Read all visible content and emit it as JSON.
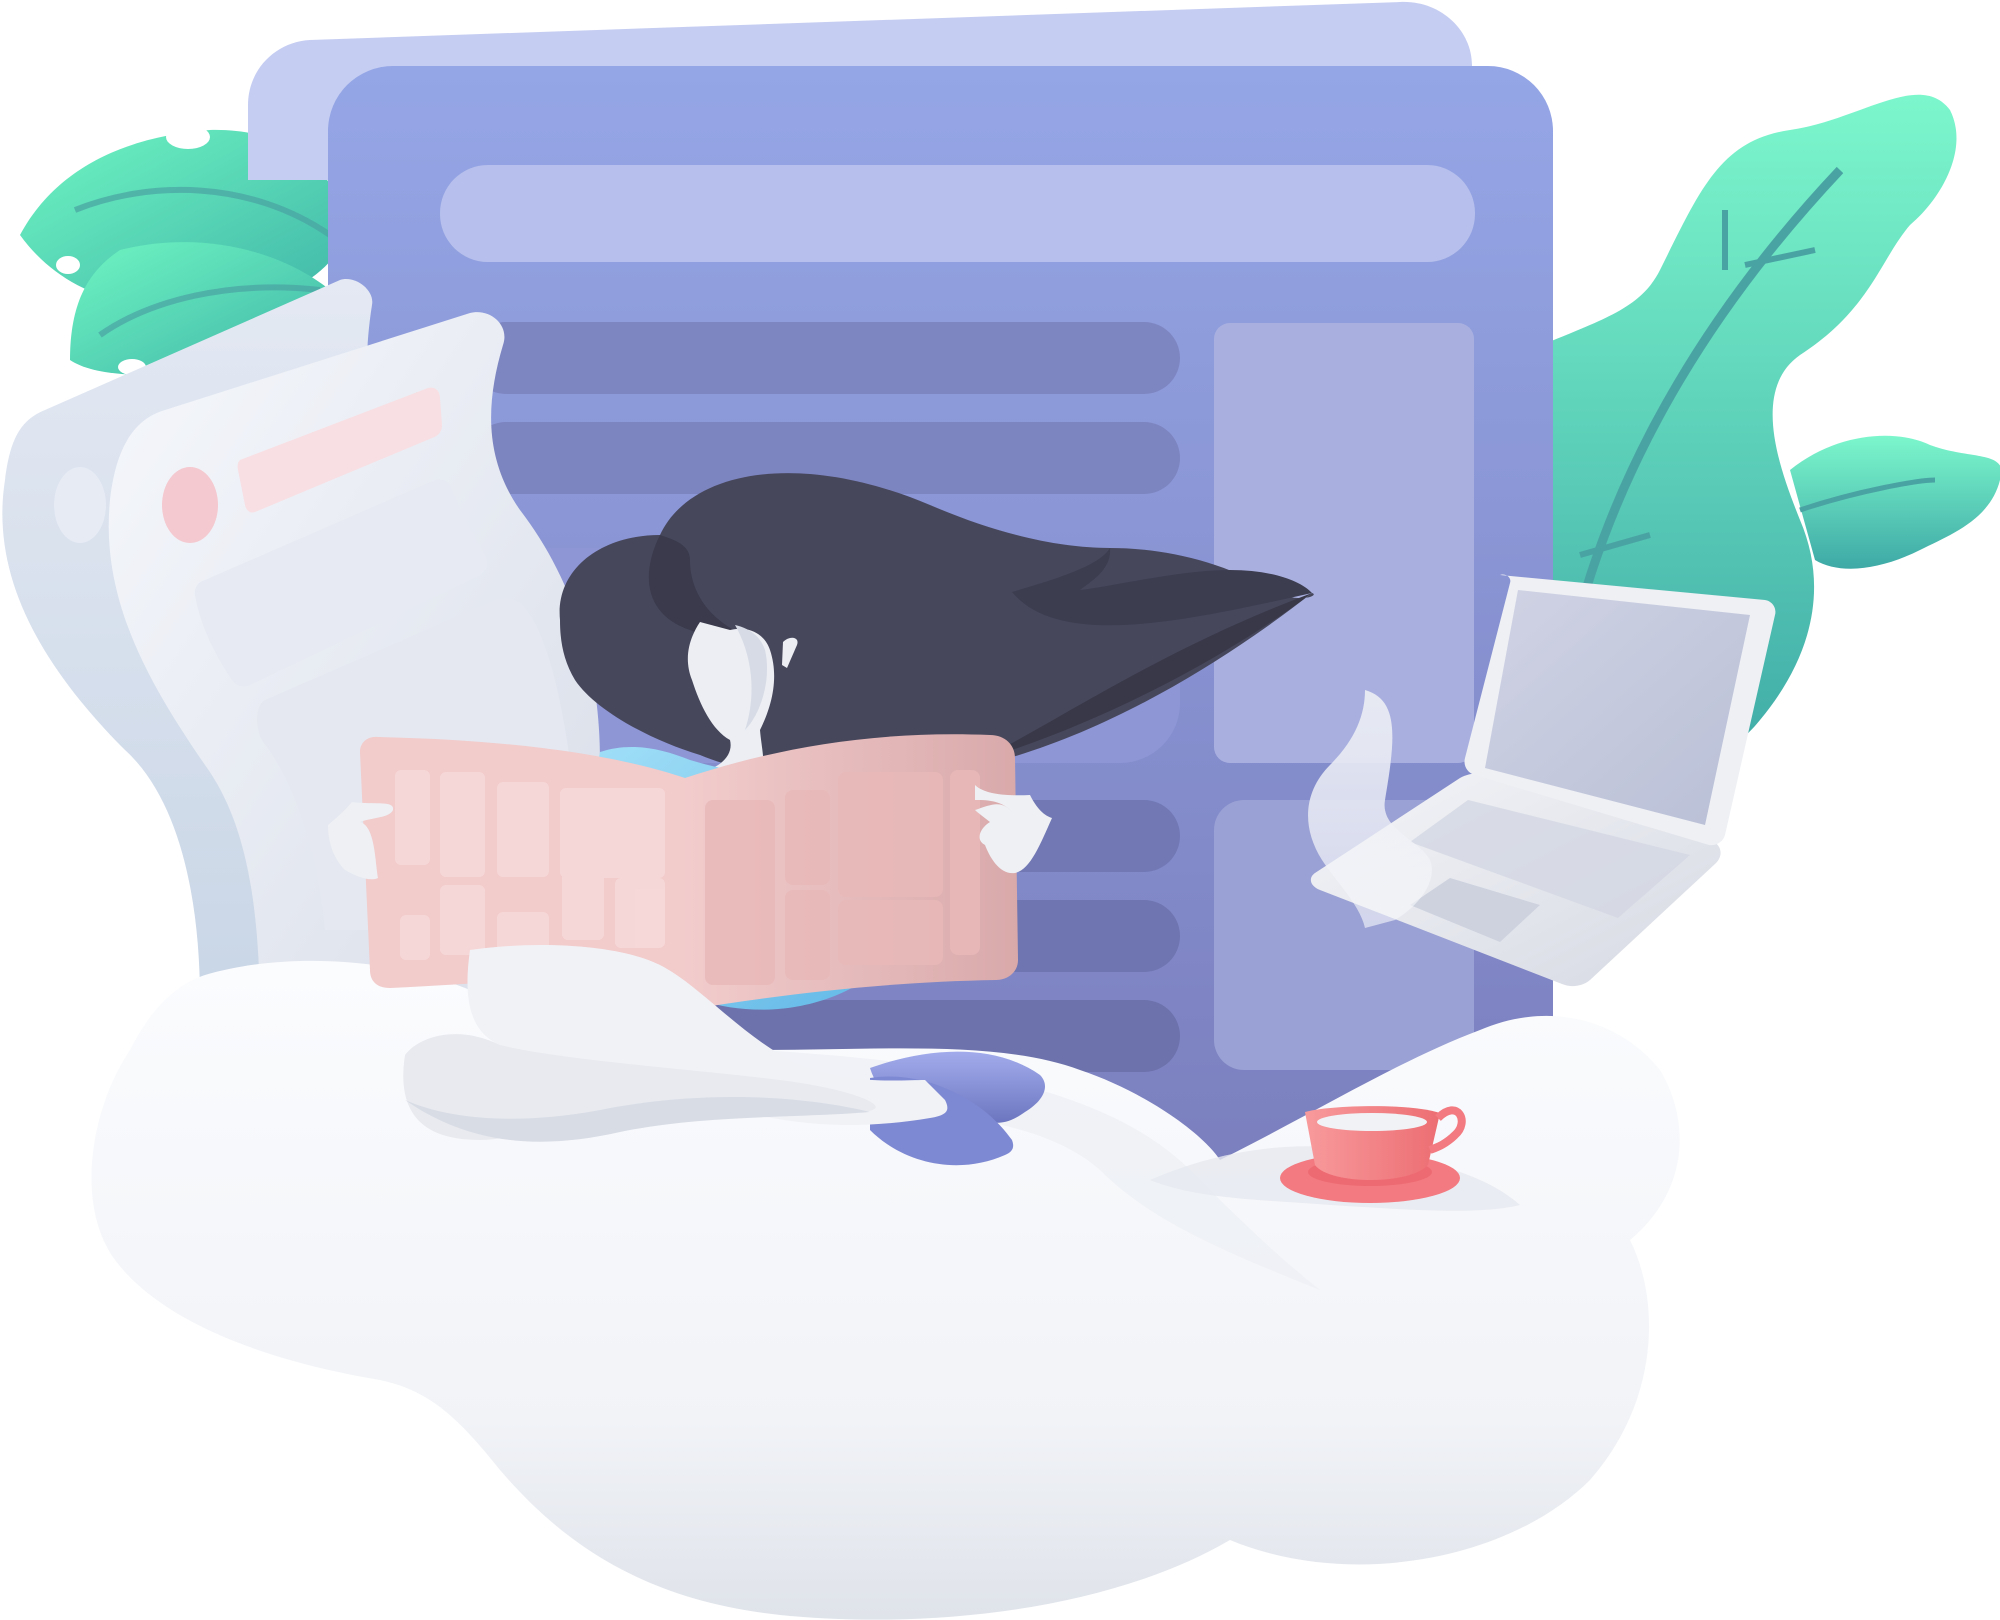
{
  "scene": {
    "subject": "person-reading-newspaper-on-cloud",
    "has_text": false
  },
  "palette": {
    "backdrop_back": "#c5cdf2",
    "backdrop_front_top": "#95a6e6",
    "backdrop_front_bottom": "#7b7fbe",
    "bar_light": "#b7c0ec",
    "bar_dark": "#6f74aa",
    "panel": "#a9b0e0",
    "leaf_light": "#6ff5c2",
    "leaf_dark": "#3fb5a8",
    "leaf_vein": "#4aa3a3",
    "hair": "#47475c",
    "hair_shadow": "#383848",
    "skin": "#f1f2f5",
    "newspaper": "#ecc3c3",
    "newspaper_shade": "#d9a9aa",
    "shirt": "#8bd4f4",
    "pants": "#8d99e3",
    "cloud": "#f7f8fb",
    "cloud_shadow": "#dfe3ea",
    "paper": "#e8ecf4",
    "paper_accent": "#f4c9cf",
    "laptop": "#e8eaf0",
    "laptop_screen": "#c4c9dc",
    "cup": "#f47f82",
    "saucer": "#f26b72"
  },
  "icons": [
    "newspaper-icon",
    "laptop-icon",
    "coffee-cup-icon",
    "leaf-icon",
    "cloud-icon",
    "document-icon"
  ]
}
